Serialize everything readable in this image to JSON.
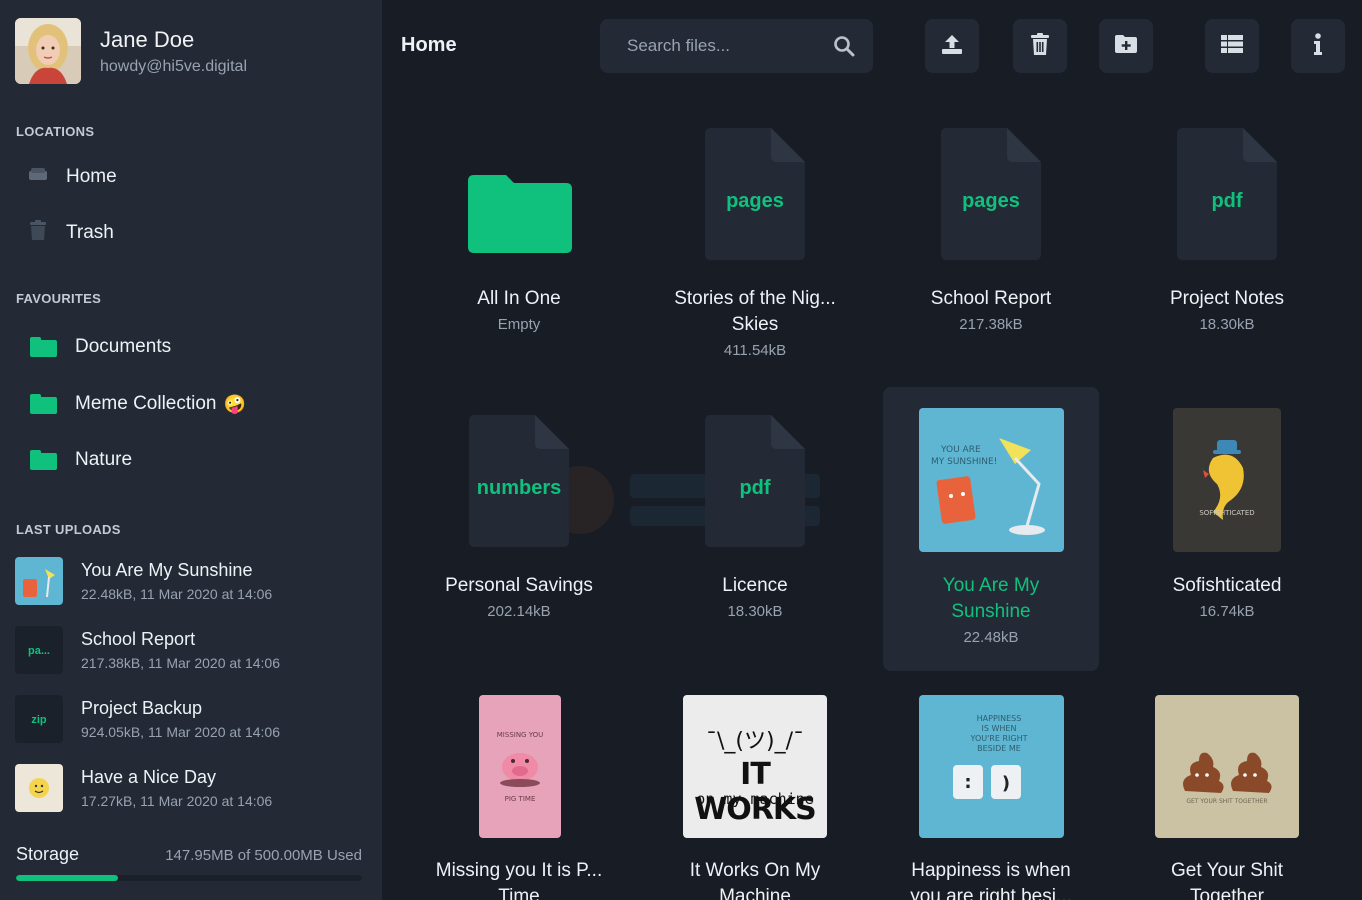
{
  "profile": {
    "name": "Jane Doe",
    "email": "howdy@hi5ve.digital"
  },
  "sections": {
    "locations": "LOCATIONS",
    "favourites": "FAVOURITES",
    "last_uploads": "LAST UPLOADS"
  },
  "locations": [
    {
      "label": "Home",
      "icon": "drive-icon"
    },
    {
      "label": "Trash",
      "icon": "trash-icon"
    }
  ],
  "favourites": [
    {
      "label": "Documents"
    },
    {
      "label": "Meme Collection",
      "emoji": "🤪"
    },
    {
      "label": "Nature"
    }
  ],
  "uploads": [
    {
      "name": "You Are My Sunshine",
      "meta": "22.48kB, 11 Mar 2020 at 14:06"
    },
    {
      "name": "School Report",
      "meta": "217.38kB, 11 Mar 2020 at 14:06",
      "ext": "pa..."
    },
    {
      "name": "Project Backup",
      "meta": "924.05kB, 11 Mar 2020 at 14:06",
      "ext": "zip"
    },
    {
      "name": "Have a Nice Day",
      "meta": "17.27kB, 11 Mar 2020 at 14:06"
    }
  ],
  "storage": {
    "label": "Storage",
    "used_text": "147.95MB of 500.00MB Used",
    "fraction": 0.296
  },
  "header": {
    "title": "Home",
    "search_placeholder": "Search files..."
  },
  "toolbar": [
    "upload-icon",
    "delete-icon",
    "new-folder-icon",
    "list-view-icon",
    "info-icon"
  ],
  "files": [
    {
      "name": "All In One",
      "size": "Empty",
      "kind": "folder"
    },
    {
      "name": "Stories of the Nig... Skies",
      "size": "411.54kB",
      "kind": "doc",
      "ext": "pages"
    },
    {
      "name": "School Report",
      "size": "217.38kB",
      "kind": "doc",
      "ext": "pages"
    },
    {
      "name": "Project Notes",
      "size": "18.30kB",
      "kind": "doc",
      "ext": "pdf"
    },
    {
      "name": "Personal Savings",
      "size": "202.14kB",
      "kind": "doc",
      "ext": "numbers"
    },
    {
      "name": "Licence",
      "size": "18.30kB",
      "kind": "doc",
      "ext": "pdf"
    },
    {
      "name": "You Are My Sunshine",
      "size": "22.48kB",
      "kind": "image",
      "selected": true,
      "caption": "YOU ARE MY SUNSHINE!"
    },
    {
      "name": "Sofishticated",
      "size": "16.74kB",
      "kind": "image",
      "caption": "SOFISHTICATED"
    },
    {
      "name": "Missing you It is P... Time",
      "size": "",
      "kind": "image",
      "caption_top": "MISSING YOU",
      "caption_bottom": "PIG TIME"
    },
    {
      "name": "It Works On My Machine",
      "size": "",
      "kind": "image",
      "caption_top": "¯\\_(ツ)_/¯",
      "caption_mid": "IT WORKS",
      "caption_bottom": "on my machine"
    },
    {
      "name": "Happiness is when you are right besi...",
      "size": "",
      "kind": "image",
      "caption": "HAPPINESS IS WHEN YOU'RE RIGHT BESIDE ME"
    },
    {
      "name": "Get Your Shit Together",
      "size": "",
      "kind": "image",
      "caption": "GET YOUR SHIT TOGETHER"
    }
  ],
  "colors": {
    "accent": "#10c17d",
    "sidebar": "#232a35",
    "background": "#181d25"
  }
}
